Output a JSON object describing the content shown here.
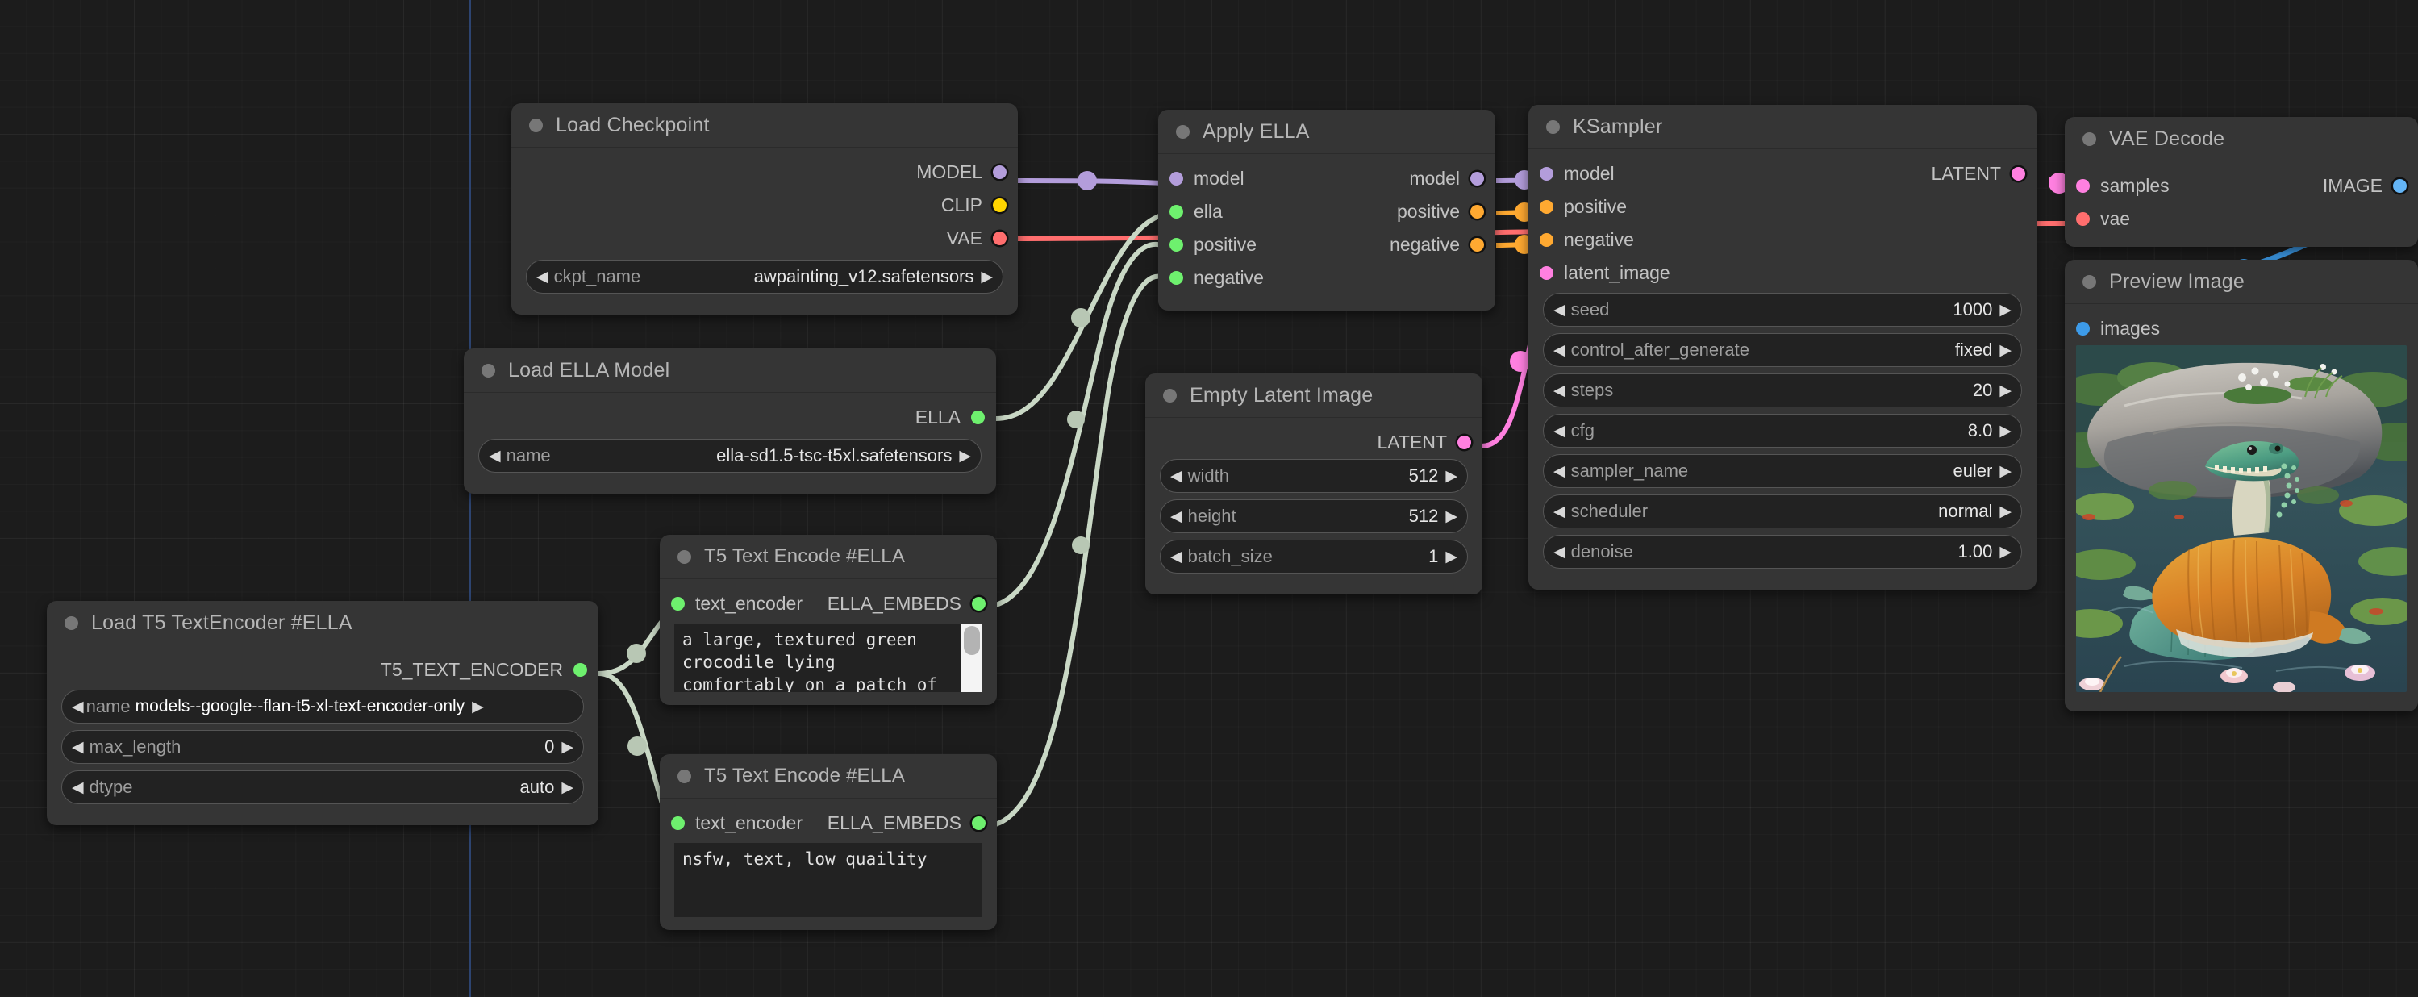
{
  "app": {
    "name": "ComfyUI Node Graph",
    "canvas_bg": "#1c1c1c",
    "axis_color": "#2d4470"
  },
  "colors": {
    "model": "#b39ddb",
    "clip": "#ffd500",
    "vae": "#ff6e6e",
    "conditioning": "#ffa931",
    "latent": "#ff80e0",
    "image": "#64b5f6",
    "ella": "#6ef06e",
    "t5": "#6ef06e"
  },
  "nodes": {
    "load_checkpoint": {
      "title": "Load Checkpoint",
      "outputs": [
        {
          "label": "MODEL",
          "color_key": "model"
        },
        {
          "label": "CLIP",
          "color_key": "clip"
        },
        {
          "label": "VAE",
          "color_key": "vae"
        }
      ],
      "widgets": [
        {
          "name": "ckpt_name",
          "value": "awpainting_v12.safetensors"
        }
      ]
    },
    "load_ella_model": {
      "title": "Load ELLA Model",
      "outputs": [
        {
          "label": "ELLA",
          "color_key": "ella"
        }
      ],
      "widgets": [
        {
          "name": "name",
          "value": "ella-sd1.5-tsc-t5xl.safetensors"
        }
      ]
    },
    "load_t5_textencoder": {
      "title": "Load T5 TextEncoder #ELLA",
      "outputs": [
        {
          "label": "T5_TEXT_ENCODER",
          "color_key": "t5"
        }
      ],
      "widgets": [
        {
          "name": "name",
          "value": "models--google--flan-t5-xl-text-encoder-only"
        },
        {
          "name": "max_length",
          "value": "0"
        },
        {
          "name": "dtype",
          "value": "auto"
        }
      ]
    },
    "t5_text_encode_positive": {
      "title": "T5 Text Encode #ELLA",
      "inputs": [
        {
          "label": "text_encoder",
          "color_key": "t5"
        }
      ],
      "outputs": [
        {
          "label": "ELLA_EMBEDS",
          "color_key": "ella"
        }
      ],
      "text": "a large, textured green crocodile lying comfortably on a patch of grass with a cute, knitted orange sweater",
      "has_scrollbar": true
    },
    "t5_text_encode_negative": {
      "title": "T5 Text Encode #ELLA",
      "inputs": [
        {
          "label": "text_encoder",
          "color_key": "t5"
        }
      ],
      "outputs": [
        {
          "label": "ELLA_EMBEDS",
          "color_key": "ella"
        }
      ],
      "text": "nsfw, text, low quaility",
      "has_scrollbar": false
    },
    "apply_ella": {
      "title": "Apply ELLA",
      "inputs": [
        {
          "label": "model",
          "color_key": "model"
        },
        {
          "label": "ella",
          "color_key": "ella"
        },
        {
          "label": "positive",
          "color_key": "ella"
        },
        {
          "label": "negative",
          "color_key": "ella"
        }
      ],
      "outputs": [
        {
          "label": "model",
          "color_key": "model"
        },
        {
          "label": "positive",
          "color_key": "conditioning"
        },
        {
          "label": "negative",
          "color_key": "conditioning"
        }
      ]
    },
    "empty_latent_image": {
      "title": "Empty Latent Image",
      "outputs": [
        {
          "label": "LATENT",
          "color_key": "latent"
        }
      ],
      "widgets": [
        {
          "name": "width",
          "value": "512"
        },
        {
          "name": "height",
          "value": "512"
        },
        {
          "name": "batch_size",
          "value": "1"
        }
      ]
    },
    "ksampler": {
      "title": "KSampler",
      "inputs": [
        {
          "label": "model",
          "color_key": "model"
        },
        {
          "label": "positive",
          "color_key": "conditioning"
        },
        {
          "label": "negative",
          "color_key": "conditioning"
        },
        {
          "label": "latent_image",
          "color_key": "latent"
        }
      ],
      "outputs": [
        {
          "label": "LATENT",
          "color_key": "latent"
        }
      ],
      "widgets": [
        {
          "name": "seed",
          "value": "1000"
        },
        {
          "name": "control_after_generate",
          "value": "fixed"
        },
        {
          "name": "steps",
          "value": "20"
        },
        {
          "name": "cfg",
          "value": "8.0"
        },
        {
          "name": "sampler_name",
          "value": "euler"
        },
        {
          "name": "scheduler",
          "value": "normal"
        },
        {
          "name": "denoise",
          "value": "1.00"
        }
      ]
    },
    "vae_decode": {
      "title": "VAE Decode",
      "inputs": [
        {
          "label": "samples",
          "color_key": "latent"
        },
        {
          "label": "vae",
          "color_key": "vae"
        }
      ],
      "outputs": [
        {
          "label": "IMAGE",
          "color_key": "image"
        }
      ]
    },
    "preview_image": {
      "title": "Preview Image",
      "inputs": [
        {
          "label": "images",
          "color_key": "image"
        }
      ],
      "image_description": "A green crocodile wearing a knitted orange sweater reclining in a lily pond beside a large grey boulder with small white flowers"
    }
  }
}
